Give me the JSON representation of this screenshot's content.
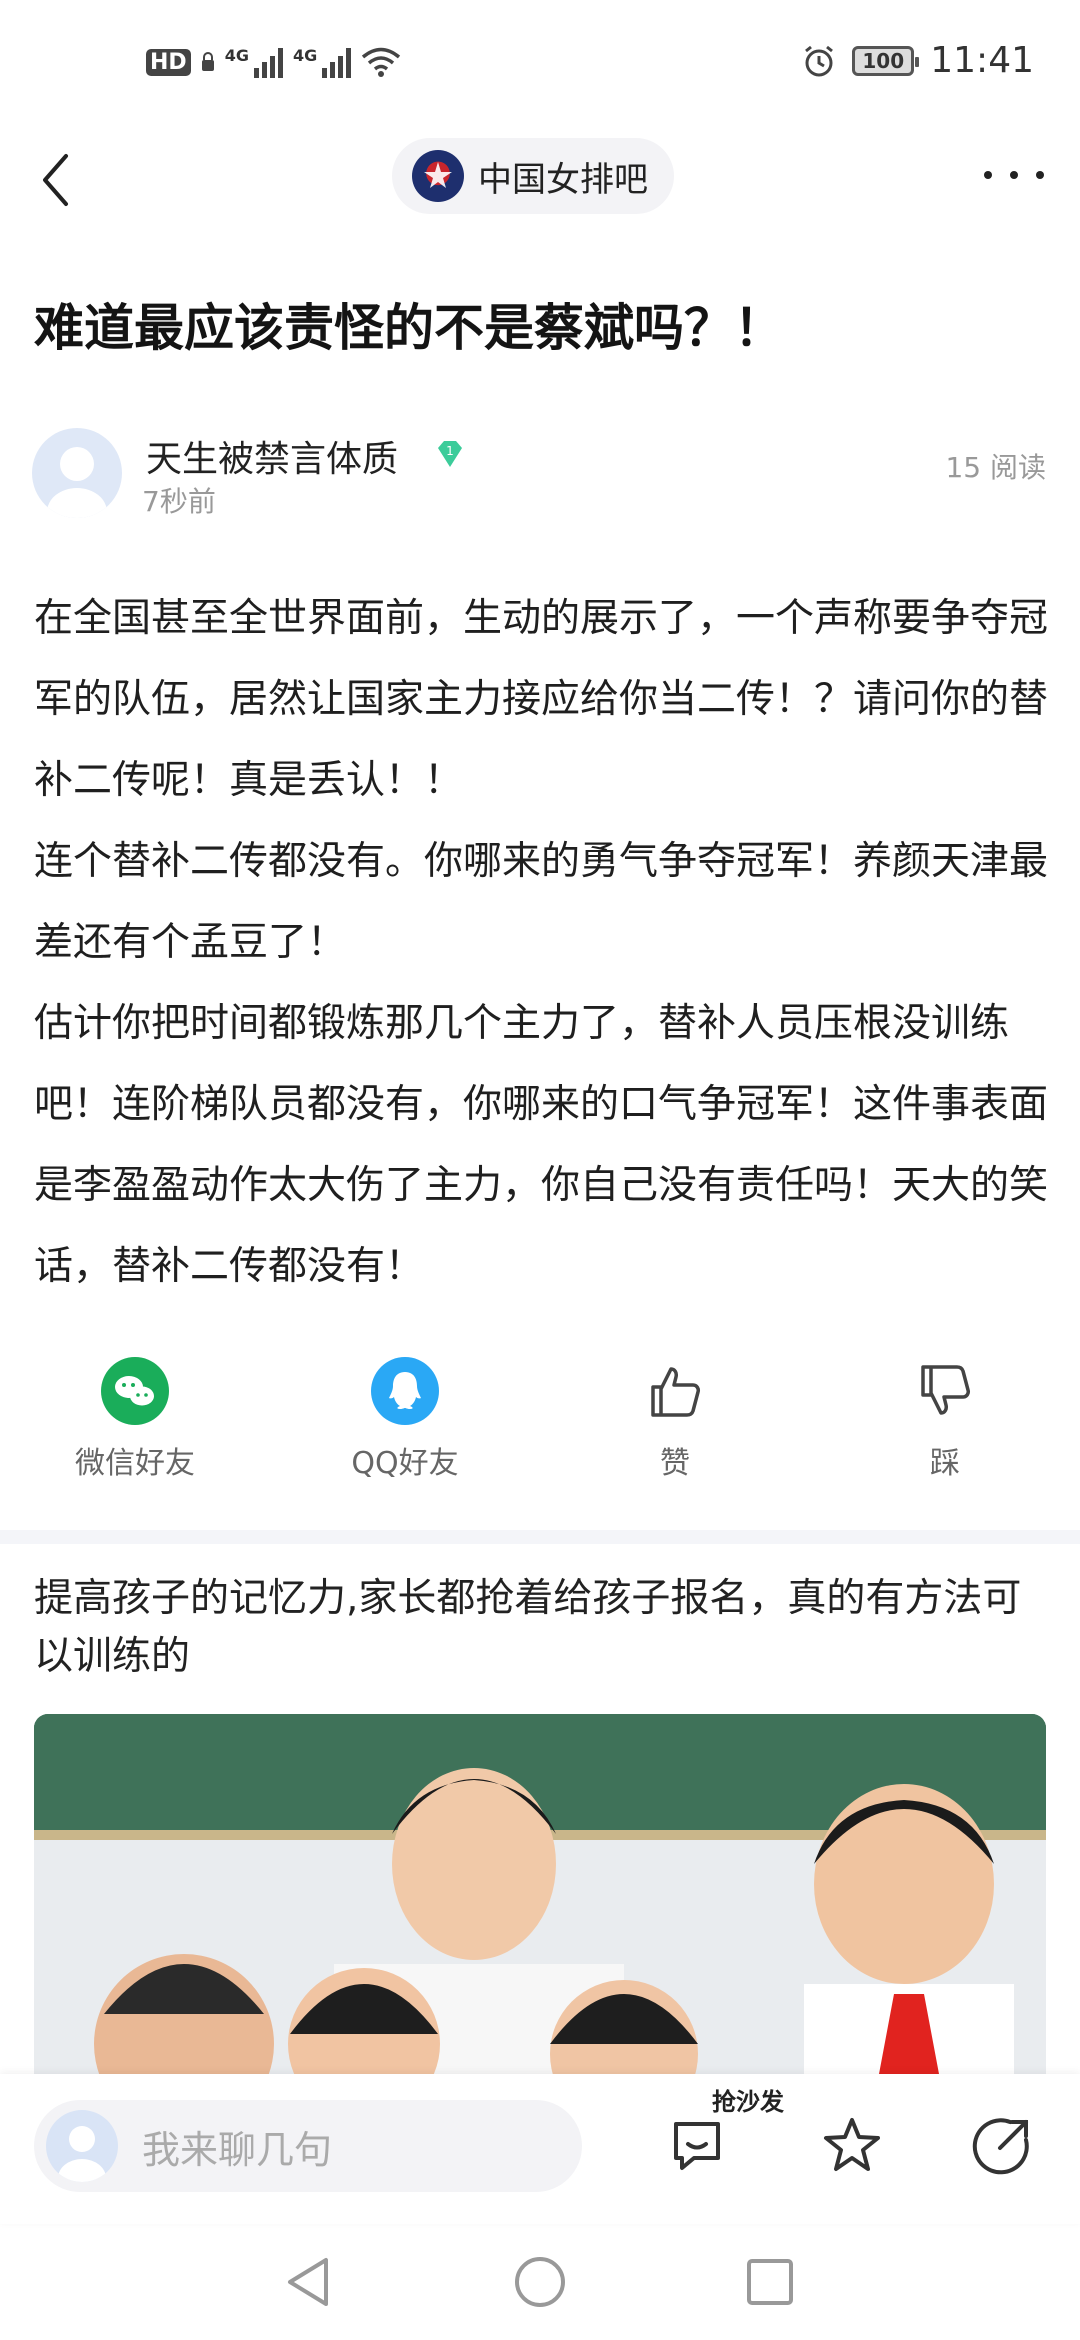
{
  "status_bar": {
    "hd_label": "HD",
    "sim1_label": "4G",
    "sim2_label": "4G",
    "battery": "100",
    "time": "11:41",
    "icons": [
      "signal-icon",
      "wifi-icon",
      "alarm-icon",
      "battery-icon"
    ]
  },
  "nav": {
    "forum_name": "中国女排吧",
    "back_icon": "chevron-left-icon",
    "more_icon": "more-icon"
  },
  "post": {
    "title": "难道最应该责怪的不是蔡斌吗？！",
    "author": "天生被禁言体质",
    "badge_level": "1",
    "time": "7秒前",
    "reads": "15 阅读",
    "body": "在全国甚至全世界面前，生动的展示了，一个声称要争夺冠军的队伍，居然让国家主力接应给你当二传！？请问你的替补二传呢！真是丢认！！\n连个替补二传都没有。你哪来的勇气争夺冠军！养颜天津最差还有个孟豆了！\n估计你把时间都锻炼那几个主力了，替补人员压根没训练吧！连阶梯队员都没有，你哪来的口气争冠军！这件事表面是李盈盈动作太大伤了主力，你自己没有责任吗！天大的笑话，替补二传都没有！"
  },
  "share": {
    "wechat": "微信好友",
    "qq": "QQ好友",
    "like": "赞",
    "dislike": "踩"
  },
  "ad": {
    "title": "提高孩子的记忆力,家长都抢着给孩子报名，真的有方法可以训练的"
  },
  "bottom_bar": {
    "comment_placeholder": "我来聊几句",
    "sofa_label": "抢沙发"
  },
  "colors": {
    "wechat": "#1aad5a",
    "qq": "#2aa8f5",
    "badge": "#3ccc9a"
  }
}
